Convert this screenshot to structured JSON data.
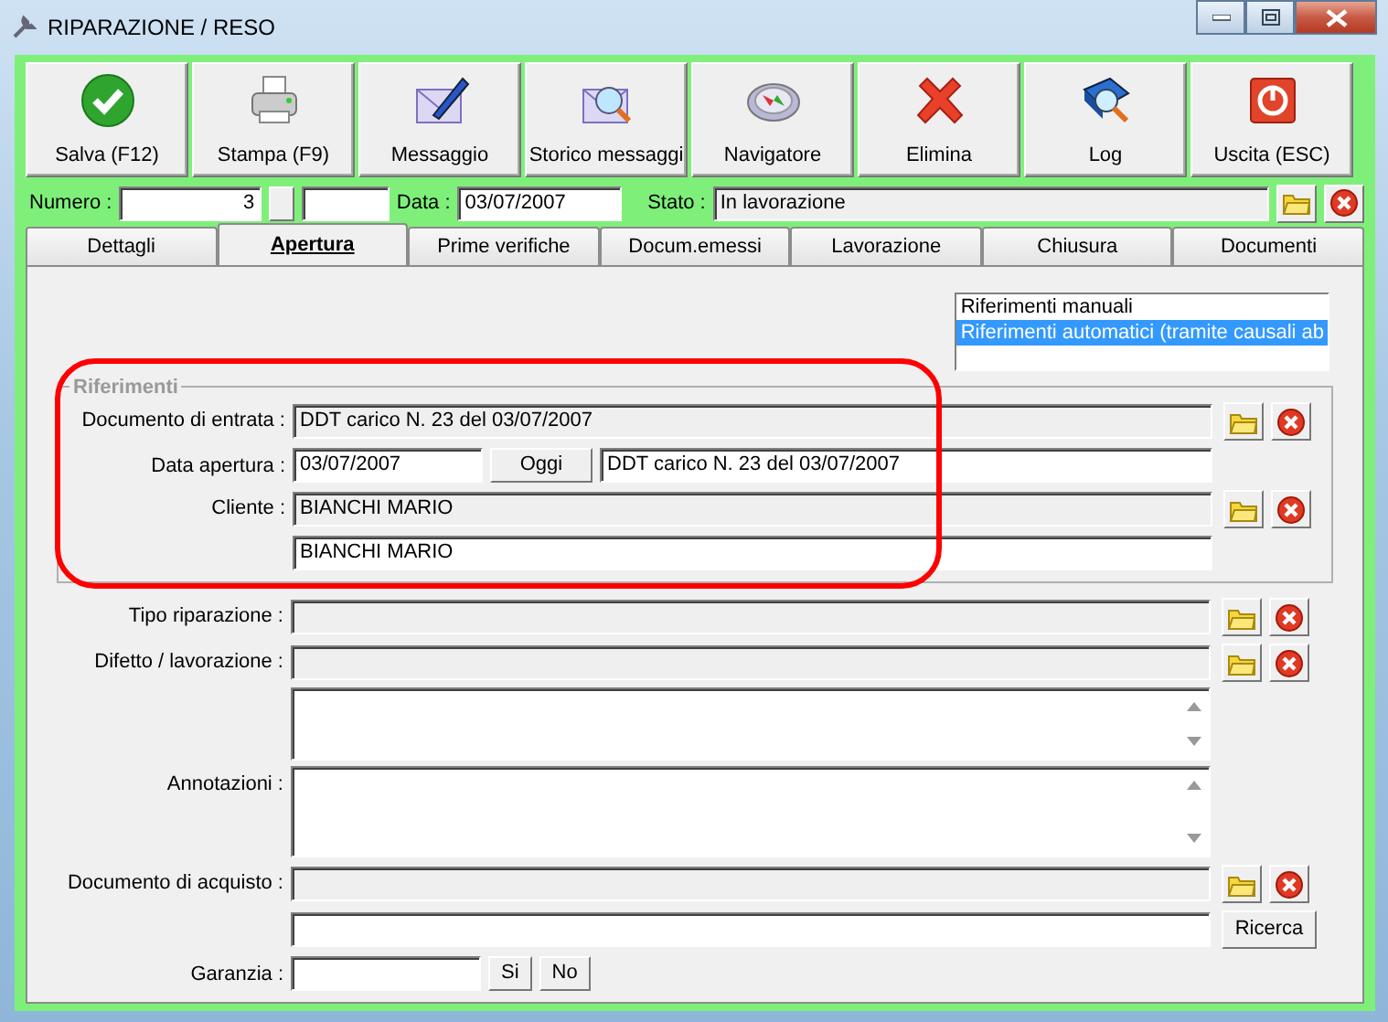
{
  "window": {
    "title": "RIPARAZIONE / RESO"
  },
  "toolbar": [
    {
      "label": "Salva (F12)"
    },
    {
      "label": "Stampa (F9)"
    },
    {
      "label": "Messaggio"
    },
    {
      "label": "Storico messaggi"
    },
    {
      "label": "Navigatore"
    },
    {
      "label": "Elimina"
    },
    {
      "label": "Log"
    },
    {
      "label": "Uscita (ESC)"
    }
  ],
  "header": {
    "numero_label": "Numero :",
    "numero": "3",
    "data_label": "Data :",
    "data": "03/07/2007",
    "stato_label": "Stato :",
    "stato": "In lavorazione"
  },
  "tabs": [
    {
      "label": "Dettagli",
      "selected": false
    },
    {
      "label": "Apertura",
      "selected": true
    },
    {
      "label": "Prime verifiche",
      "selected": false
    },
    {
      "label": "Docum.emessi",
      "selected": false
    },
    {
      "label": "Lavorazione",
      "selected": false
    },
    {
      "label": "Chiusura",
      "selected": false
    },
    {
      "label": "Documenti",
      "selected": false
    }
  ],
  "reference_mode": [
    {
      "label": "Riferimenti manuali",
      "selected": false
    },
    {
      "label": "Riferimenti automatici (tramite causali ab",
      "selected": true
    }
  ],
  "riferimenti": {
    "legend": "Riferimenti",
    "highlighted": true,
    "rows": [
      {
        "label": "Documento di entrata :",
        "lookup": true,
        "cells": [
          {
            "kind": "readonly",
            "value": "DDT carico N. 23 del 03/07/2007"
          }
        ]
      },
      {
        "label": "Data apertura :",
        "lookup": false,
        "cells": [
          {
            "kind": "short-input",
            "value": "03/07/2007"
          },
          {
            "kind": "button",
            "text": "Oggi"
          },
          {
            "kind": "input",
            "value": "DDT carico N. 23 del 03/07/2007"
          }
        ]
      },
      {
        "label": "Cliente :",
        "lookup": true,
        "cells": [
          {
            "kind": "readonly",
            "value": "BIANCHI MARIO"
          }
        ]
      },
      {
        "lookup": false,
        "cells": [
          {
            "kind": "input",
            "value": "BIANCHI MARIO"
          }
        ]
      }
    ]
  },
  "fields": [
    {
      "label": "Tipo riparazione :",
      "lookup": true,
      "cells": [
        {
          "kind": "readonly"
        }
      ]
    },
    {
      "label": "Difetto / lavorazione :",
      "lookup": true,
      "cells": [
        {
          "kind": "readonly"
        }
      ]
    },
    {
      "lookup": false,
      "cells": [
        {
          "kind": "textarea"
        }
      ]
    },
    {
      "label": "Annotazioni :",
      "lookup": false,
      "cells": [
        {
          "kind": "textarea"
        }
      ]
    },
    {
      "label": "Documento di acquisto :",
      "lookup": true,
      "cells": [
        {
          "kind": "readonly"
        }
      ]
    },
    {
      "lookup": false,
      "cells": [
        {
          "kind": "input"
        }
      ],
      "action_button": "Ricerca"
    },
    {
      "label": "Garanzia :",
      "lookup": false,
      "cells": [
        {
          "kind": "short-input"
        },
        {
          "kind": "button",
          "text": "Si"
        },
        {
          "kind": "button",
          "text": "No"
        }
      ]
    }
  ]
}
